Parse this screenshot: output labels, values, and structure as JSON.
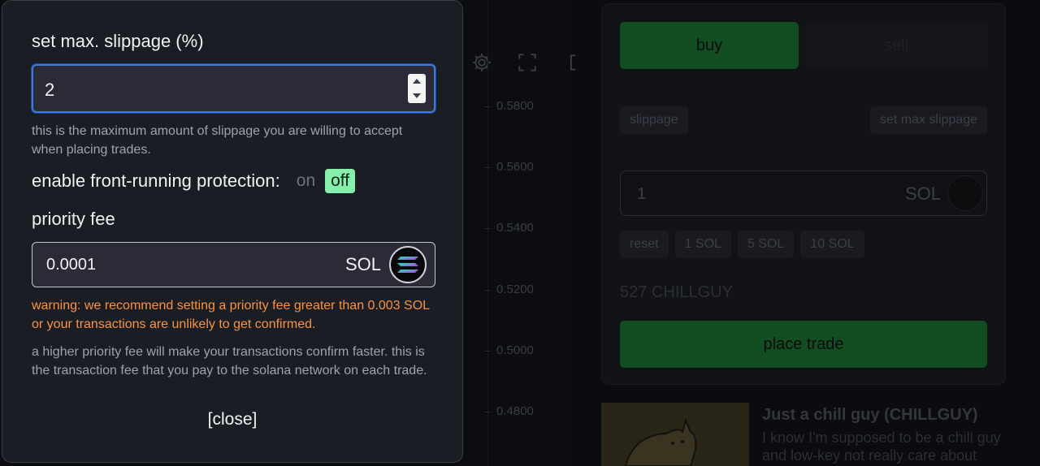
{
  "background": {
    "price_ticks": [
      "0.5800",
      "0.5600",
      "0.5400",
      "0.5200",
      "0.5000",
      "0.4800"
    ],
    "trade_panel": {
      "buy_tab": "buy",
      "sell_tab": "sell",
      "slippage_chip": "slippage",
      "set_max_slippage_chip": "set max slippage",
      "amount_value": "1",
      "amount_unit": "SOL",
      "quick_buttons": [
        "reset",
        "1 SOL",
        "5 SOL",
        "10 SOL"
      ],
      "token_amount": "527 CHILLGUY",
      "place_trade": "place trade"
    },
    "token_card": {
      "title": "Just a chill guy (CHILLGUY)",
      "description": "I know I'm supposed to be a chill guy and low-key not really care about"
    }
  },
  "modal": {
    "slippage_label": "set max. slippage (%)",
    "slippage_value": "2",
    "slippage_help": "this is the maximum amount of slippage you are willing to accept when placing trades.",
    "front_running_label": "enable front-running protection:",
    "front_running_on": "on",
    "front_running_off": "off",
    "priority_fee_label": "priority fee",
    "priority_fee_value": "0.0001",
    "priority_fee_unit": "SOL",
    "warning": "warning: we recommend setting a priority fee greater than 0.003 SOL or your transactions are unlikely to get confirmed.",
    "fee_help": "a higher priority fee will make your transactions confirm faster. this is the transaction fee that you pay to the solana network on each trade.",
    "close_label": "[close]"
  },
  "colors": {
    "accent_green": "#86efac",
    "warning_orange": "#fb923c",
    "focus_blue": "#3d7bd9"
  }
}
